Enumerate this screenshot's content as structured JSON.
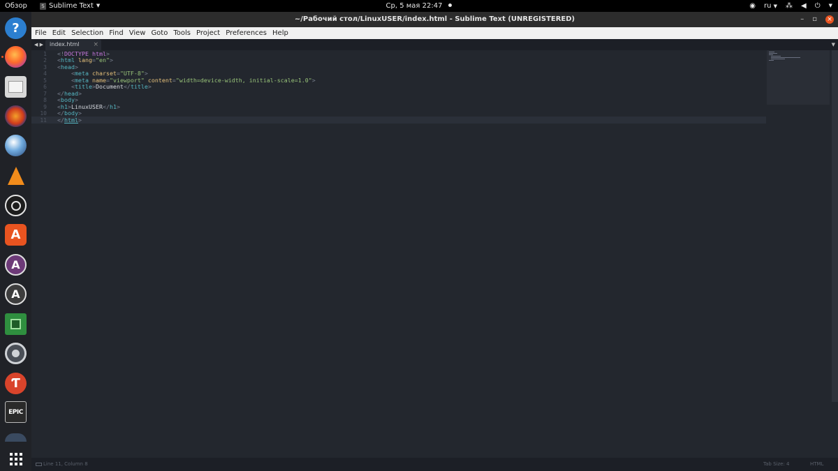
{
  "topbar": {
    "activities": "Обзор",
    "app_name": "Sublime Text",
    "clock": "Ср, 5 мая  22:47",
    "lang": "ru"
  },
  "window": {
    "title": "~/Рабочий стол/LinuxUSER/index.html - Sublime Text (UNREGISTERED)"
  },
  "menu": [
    "File",
    "Edit",
    "Selection",
    "Find",
    "View",
    "Goto",
    "Tools",
    "Project",
    "Preferences",
    "Help"
  ],
  "tab": {
    "label": "index.html"
  },
  "editor": {
    "line_numbers": [
      "1",
      "2",
      "3",
      "4",
      "5",
      "6",
      "7",
      "8",
      "9",
      "10",
      "11"
    ],
    "lines": {
      "l1": {
        "a": "<!",
        "b": "DOCTYPE html",
        "c": ">"
      },
      "l2": {
        "a": "<",
        "b": "html",
        "c": " lang",
        "d": "=",
        "e": "\"en\"",
        "f": ">"
      },
      "l3": {
        "a": "<",
        "b": "head",
        "c": ">"
      },
      "l4": {
        "a": "    <",
        "b": "meta",
        "c": " charset",
        "d": "=",
        "e": "\"UTF-8\"",
        "f": ">"
      },
      "l5": {
        "a": "    <",
        "b": "meta",
        "c": " name",
        "d": "=",
        "e": "\"viewport\"",
        "f": " content",
        "g": "=",
        "h": "\"width=device-width, initial-scale=1.0\"",
        "i": ">"
      },
      "l6": {
        "a": "    <",
        "b": "title",
        "c": ">",
        "d": "Document",
        "e": "</",
        "f": "title",
        "g": ">"
      },
      "l7": {
        "a": "</",
        "b": "head",
        "c": ">"
      },
      "l8": {
        "a": "<",
        "b": "body",
        "c": ">"
      },
      "l9": {
        "a": "<",
        "b": "h1",
        "c": ">",
        "d": "LinuxUSER",
        "e": "</",
        "f": "h1",
        "g": ">"
      },
      "l10": {
        "a": "</",
        "b": "body",
        "c": ">"
      },
      "l11": {
        "a": "</",
        "b": "html",
        "c": ">"
      }
    }
  },
  "statusbar": {
    "position": "Line 11, Column 8",
    "tab_size": "Tab Size: 4",
    "syntax": "HTML"
  },
  "colors": {
    "accent": "#e95420",
    "editor_bg": "#23272e",
    "tag": "#56b6c2",
    "attr": "#e5c07b",
    "string": "#98c379"
  },
  "dock": {
    "items": [
      "help-icon",
      "firefox-icon",
      "files-icon",
      "audacity-icon",
      "obs-studio-icon",
      "vlc-icon",
      "obs-icon",
      "software-center-icon",
      "app-store-icon",
      "app-installer-icon",
      "system-monitor-icon",
      "settings-icon",
      "app-icon",
      "epic-games-icon",
      "steam-icon",
      "show-apps-icon"
    ],
    "epic_label": "EPIC"
  }
}
